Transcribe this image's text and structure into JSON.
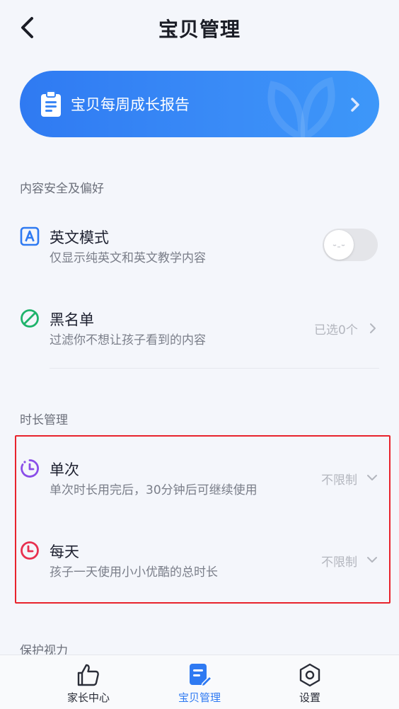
{
  "header": {
    "title": "宝贝管理",
    "back_icon": "chevron-left-icon"
  },
  "banner": {
    "label": "宝贝每周成长报告",
    "icon": "report-clipboard-icon",
    "gradient": [
      "#2f7af2",
      "#3d97f9"
    ]
  },
  "sections": {
    "content_safety": {
      "title": "内容安全及偏好",
      "english_mode": {
        "title": "英文模式",
        "desc": "仅显示纯英文和英文教学内容",
        "enabled": false,
        "icon": "letter-a-icon"
      },
      "blacklist": {
        "title": "黑名单",
        "desc": "过滤你不想让孩子看到的内容",
        "value": "已选0个",
        "icon": "forbidden-icon"
      }
    },
    "duration": {
      "title": "时长管理",
      "single": {
        "title": "单次",
        "desc": "单次时长用完后，30分钟后可继续使用",
        "value": "不限制",
        "icon": "timer-icon"
      },
      "daily": {
        "title": "每天",
        "desc": "孩子一天使用小小优酷的总时长",
        "value": "不限制",
        "icon": "clock-icon"
      }
    },
    "eye_protection": {
      "title": "保护视力"
    }
  },
  "tabbar": {
    "items": [
      {
        "label": "家长中心",
        "icon": "thumbs-up-icon",
        "active": false
      },
      {
        "label": "宝贝管理",
        "icon": "edit-document-icon",
        "active": true
      },
      {
        "label": "设置",
        "icon": "settings-hex-icon",
        "active": false
      }
    ]
  },
  "colors": {
    "accent": "#2f7af2",
    "highlight": "#e8232c",
    "background": "#f4f6fb"
  }
}
